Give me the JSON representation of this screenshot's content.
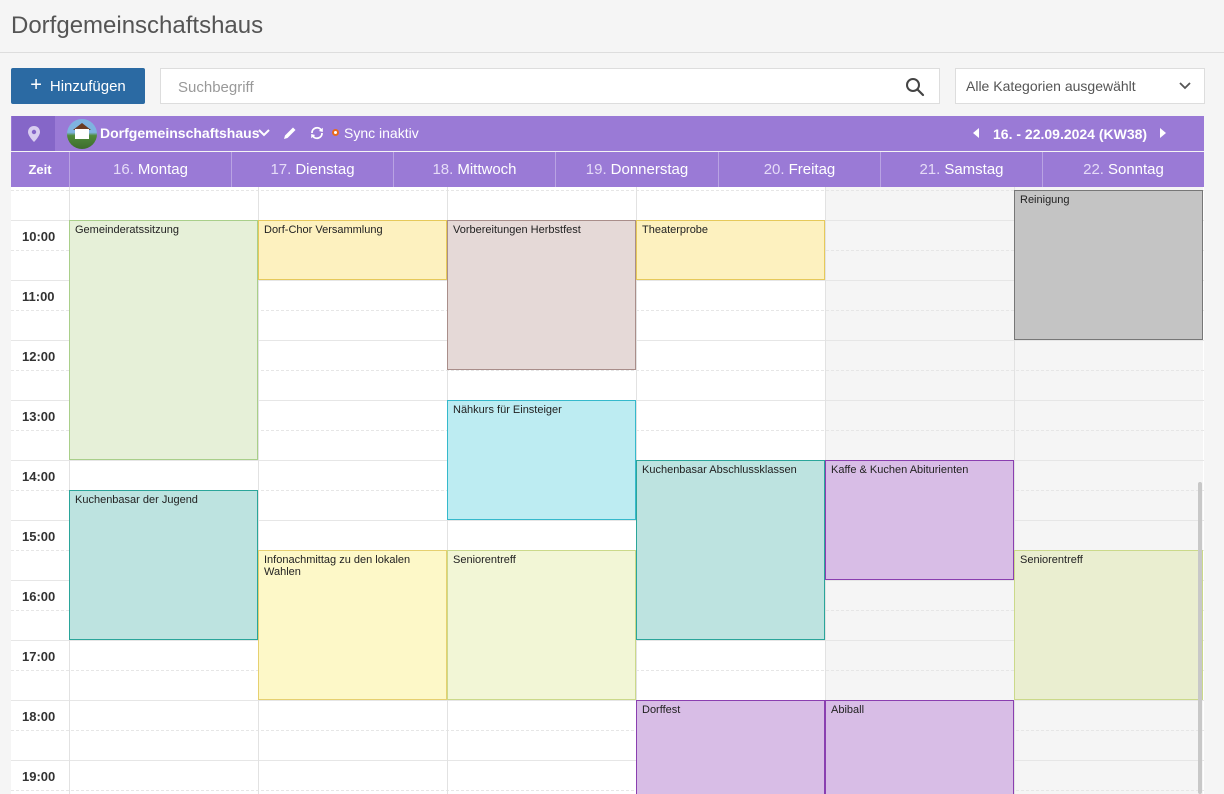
{
  "page": {
    "title": "Dorfgemeinschaftshaus"
  },
  "toolbar": {
    "add_label": "Hinzufügen",
    "search_placeholder": "Suchbegriff",
    "category_select": "Alle Kategorien ausgewählt"
  },
  "calendar_bar": {
    "location": "Dorfgemeinschaftshaus",
    "sync_status": "Sync inaktiv",
    "week_range": "16. - 22.09.2024 (KW38)",
    "accent": "#9a7ad6"
  },
  "header": {
    "time_col": "Zeit",
    "days": [
      {
        "num": "16.",
        "name": "Montag"
      },
      {
        "num": "17.",
        "name": "Dienstag"
      },
      {
        "num": "18.",
        "name": "Mittwoch"
      },
      {
        "num": "19.",
        "name": "Donnerstag"
      },
      {
        "num": "20.",
        "name": "Freitag"
      },
      {
        "num": "21.",
        "name": "Samstag"
      },
      {
        "num": "22.",
        "name": "Sonntag"
      }
    ]
  },
  "time_labels": [
    "10:00",
    "11:00",
    "12:00",
    "13:00",
    "14:00",
    "15:00",
    "16:00",
    "17:00",
    "18:00",
    "19:00"
  ],
  "events": [
    {
      "title": "Gemeinderatssitzung",
      "day": 0,
      "start": 10.0,
      "end": 14.0,
      "bg": "#e6f0d8",
      "border": "#a9cf8a"
    },
    {
      "title": "Kuchenbasar der Jugend",
      "day": 0,
      "start": 14.5,
      "end": 17.0,
      "bg": "#bde3e0",
      "border": "#2aa59a"
    },
    {
      "title": "Dorf-Chor Versammlung",
      "day": 1,
      "start": 10.0,
      "end": 11.0,
      "bg": "#fdf1bf",
      "border": "#e6c95a"
    },
    {
      "title": "Infonachmittag zu den lokalen Wahlen",
      "day": 1,
      "start": 15.5,
      "end": 18.0,
      "bg": "#fdf8c8",
      "border": "#e6d070"
    },
    {
      "title": "Vorbereitungen Herbstfest",
      "day": 2,
      "start": 10.0,
      "end": 12.5,
      "bg": "#e5d9d7",
      "border": "#a98e8a"
    },
    {
      "title": "Nähkurs für Einsteiger",
      "day": 2,
      "start": 13.0,
      "end": 15.0,
      "bg": "#bdecf2",
      "border": "#35b9cc"
    },
    {
      "title": "Seniorentreff",
      "day": 2,
      "start": 15.5,
      "end": 18.0,
      "bg": "#f2f6d6",
      "border": "#cbd98a"
    },
    {
      "title": "Theaterprobe",
      "day": 3,
      "start": 10.0,
      "end": 11.0,
      "bg": "#fdf1bf",
      "border": "#e6c95a"
    },
    {
      "title": "Kuchenbasar Abschlussklassen",
      "day": 3,
      "start": 14.0,
      "end": 17.0,
      "bg": "#bde3e0",
      "border": "#2aa59a"
    },
    {
      "title": "Dorffest",
      "day": 3,
      "start": 18.0,
      "end": 20.0,
      "bg": "#d8bde6",
      "border": "#8a3fb0"
    },
    {
      "title": "Kaffe & Kuchen Abiturienten",
      "day": 4,
      "start": 14.0,
      "end": 16.0,
      "bg": "#d8bde6",
      "border": "#8a3fb0"
    },
    {
      "title": "Abiball",
      "day": 4,
      "start": 18.0,
      "end": 20.0,
      "bg": "#d8bde6",
      "border": "#8a3fb0"
    },
    {
      "title": "Reinigung",
      "day": 5,
      "start": 9.5,
      "end": 12.0,
      "bg": "#c4c4c4",
      "border": "#777777"
    },
    {
      "title": "Seniorentreff",
      "day": 5,
      "start": 15.5,
      "end": 18.0,
      "bg": "#eaeed0",
      "border": "#cbd98a"
    }
  ]
}
